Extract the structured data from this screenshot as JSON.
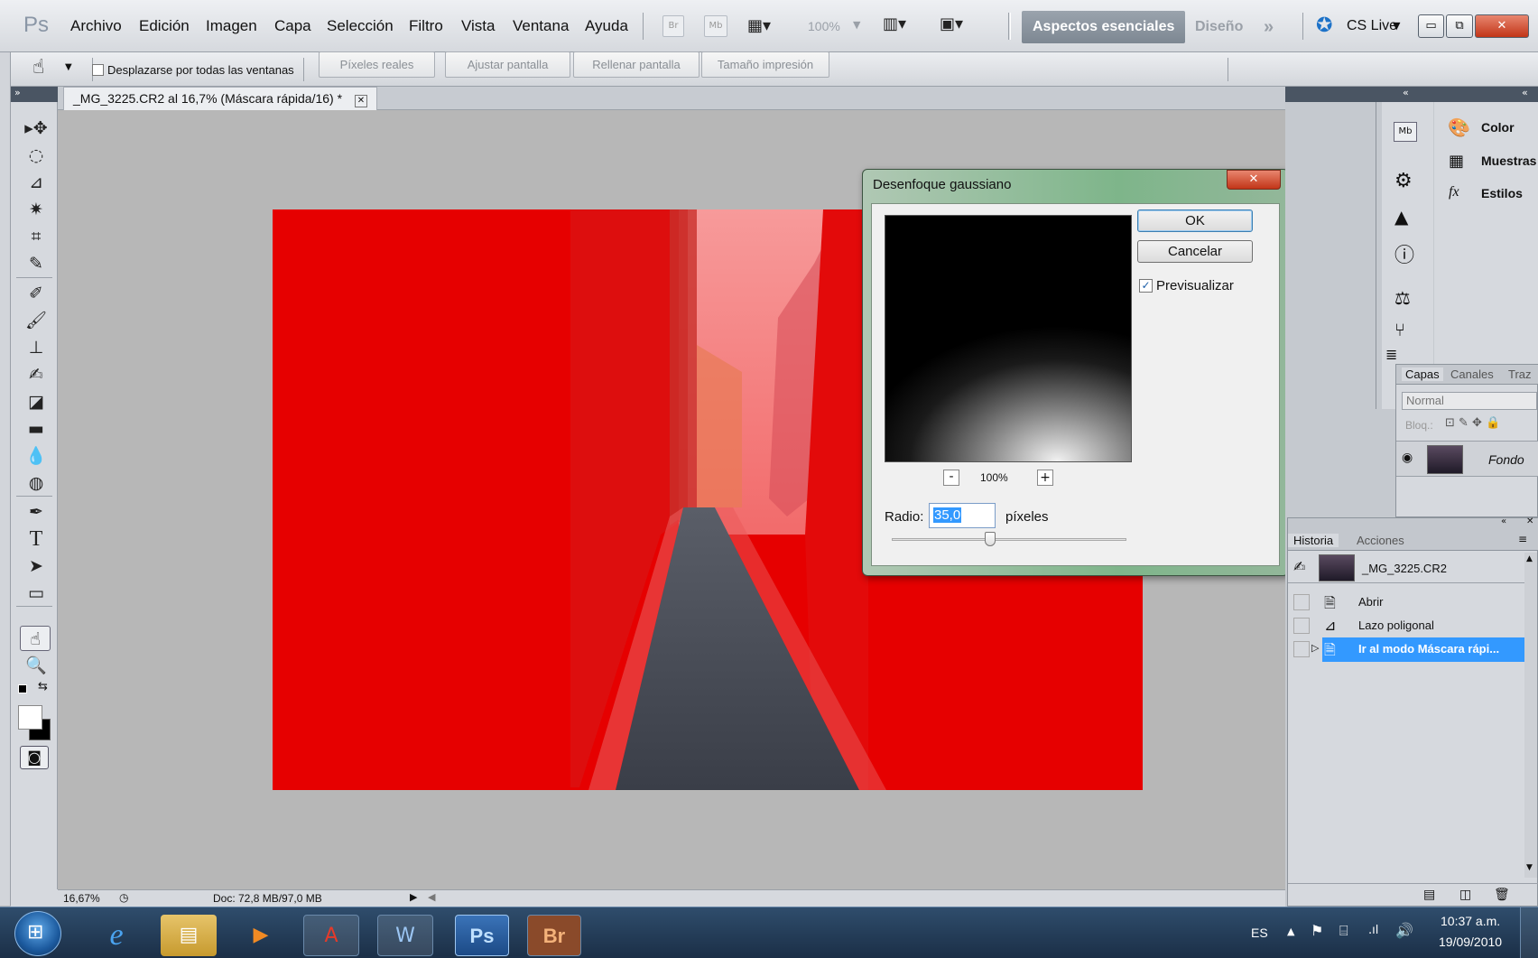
{
  "app": {
    "logo": "Ps"
  },
  "menu": [
    "Archivo",
    "Edición",
    "Imagen",
    "Capa",
    "Selección",
    "Filtro",
    "Vista",
    "Ventana",
    "Ayuda"
  ],
  "toolbar": {
    "br_label": "Br",
    "mb_label": "Mb",
    "zoom": "100%",
    "workspace_active": "Aspectos esenciales",
    "workspace_other": "Diseño",
    "more": "»",
    "cslive": "CS Live"
  },
  "options": {
    "scroll_all_windows": "Desplazarse por todas las ventanas",
    "buttons": [
      "Píxeles reales",
      "Ajustar pantalla",
      "Rellenar pantalla",
      "Tamaño impresión"
    ]
  },
  "document": {
    "tab_title": "_MG_3225.CR2 al 16,7% (Máscara rápida/16) *"
  },
  "status": {
    "zoom": "16,67%",
    "doc": "Doc: 72,8 MB/97,0 MB"
  },
  "dialog": {
    "title": "Desenfoque gaussiano",
    "ok": "OK",
    "cancel": "Cancelar",
    "preview_label": "Previsualizar",
    "preview_checked": true,
    "zoom_minus": "-",
    "zoom_value": "100%",
    "zoom_plus": "+",
    "radius_label": "Radio:",
    "radius_value": "35,0",
    "radius_unit": "píxeles",
    "slider_fraction": 0.42
  },
  "panels_top": [
    {
      "label": "Color",
      "icon": "color-palette-icon"
    },
    {
      "label": "Muestras",
      "icon": "swatches-grid-icon"
    },
    {
      "label": "Estilos",
      "icon": "fx-styles-icon"
    }
  ],
  "layers": {
    "tabs": [
      "Capas",
      "Canales",
      "Traz"
    ],
    "blend_mode": "Normal",
    "lock_label": "Bloq.:",
    "layer_name": "Fondo"
  },
  "history": {
    "tabs": [
      "Historia",
      "Acciones"
    ],
    "snapshot": "_MG_3225.CR2",
    "items": [
      "Abrir",
      "Lazo poligonal",
      "Ir al modo Máscara rápi..."
    ],
    "selected_index": 2
  },
  "taskbar": {
    "apps": [
      "Internet Explorer",
      "Explorador",
      "Reproductor",
      "Adobe Acrobat",
      "Word",
      "Photoshop",
      "Bridge"
    ],
    "ps_label": "Ps",
    "br_label": "Br",
    "lang": "ES",
    "time": "10:37 a.m.",
    "date": "19/09/2010"
  },
  "colors": {
    "mask_red": "#e60000",
    "selection_blue": "#3399ff",
    "ps_blue": "#1d5fa8"
  }
}
